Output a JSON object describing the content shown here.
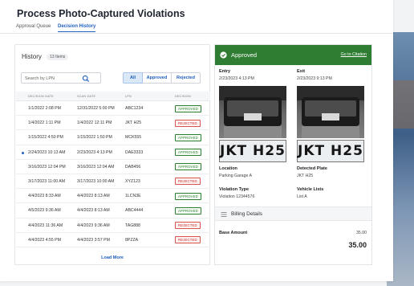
{
  "page": {
    "title": "Process Photo-Captured Violations"
  },
  "tabs": [
    {
      "label": "Approval Queue",
      "active": false
    },
    {
      "label": "Decision History",
      "active": true
    }
  ],
  "history": {
    "title": "History",
    "count_label": "13 Items",
    "search_placeholder": "Search by LPN",
    "filters": [
      "All",
      "Approved",
      "Rejected"
    ],
    "active_filter": "All",
    "columns": [
      "DECISION DATE",
      "SCAN DATE",
      "LPN",
      "DECISION"
    ],
    "rows": [
      {
        "decision_date": "1/1/2022  2:08 PM",
        "scan_date": "12/31/2022  5:00 PM",
        "lpn": "ABC1234",
        "decision": "APPROVED",
        "selected": false
      },
      {
        "decision_date": "1/4/2022 1:11 PM",
        "scan_date": "1/4/2022 12:11 PM",
        "lpn": "JKT H25",
        "decision": "REJECTED",
        "selected": false
      },
      {
        "decision_date": "1/15/2022 4:50 PM",
        "scan_date": "1/15/2022 1:50 PM",
        "lpn": "MCK555",
        "decision": "APPROVED",
        "selected": false
      },
      {
        "decision_date": "2/24/2023 10:13 AM",
        "scan_date": "2/23/2023 4:13 PM",
        "lpn": "DAE3333",
        "decision": "APPROVED",
        "selected": true
      },
      {
        "decision_date": "3/16/2023 12:04 PM",
        "scan_date": "3/16/2023 12:04 AM",
        "lpn": "DAB456",
        "decision": "APPROVED",
        "selected": false
      },
      {
        "decision_date": "3/17/2023 11:00 AM",
        "scan_date": "3/17/2023 10:00 AM",
        "lpn": "XYZ123",
        "decision": "REJECTED",
        "selected": false
      },
      {
        "decision_date": "4/4/2023 8:33 AM",
        "scan_date": "4/4/2023 8:13 AM",
        "lpn": "1LCN3E",
        "decision": "APPROVED",
        "selected": false
      },
      {
        "decision_date": "4/5/2023 9:36 AM",
        "scan_date": "4/4/2023 8:13 AM",
        "lpn": "ABC4444",
        "decision": "APPROVED",
        "selected": false
      },
      {
        "decision_date": "4/4/2023 11:36 AM",
        "scan_date": "4/4/2023 9:36 AM",
        "lpn": "TAG888",
        "decision": "REJECTED",
        "selected": false
      },
      {
        "decision_date": "4/4/2023 4:55 PM",
        "scan_date": "4/4/2023 3:57 PM",
        "lpn": "8PZZA",
        "decision": "REJECTED",
        "selected": false
      }
    ],
    "load_more_label": "Load More"
  },
  "detail": {
    "status": "Approved",
    "citation_link": "Go to Citation",
    "entry": {
      "label": "Entry",
      "timestamp": "2/23/2023 4:13 PM",
      "plate_text": "JKT H25"
    },
    "exit": {
      "label": "Exit",
      "timestamp": "2/23/2023 9:13 PM",
      "plate_text": "JKT H25"
    },
    "location": {
      "label": "Location",
      "value": "Parking Garage A"
    },
    "detected_plate": {
      "label": "Detected Plate",
      "value": "JKT H25"
    },
    "violation_type": {
      "label": "Violation Type",
      "value": "Violation 12344576"
    },
    "vehicle_lists": {
      "label": "Vehicle Lists",
      "value": "List A"
    },
    "billing": {
      "title": "Billing Details",
      "base_amount_label": "Base Amount",
      "base_amount_value": "35.00",
      "total_value": "35.00"
    }
  },
  "colors": {
    "accent": "#1f5fbf",
    "approved": "#2e7d32",
    "rejected": "#c62828"
  },
  "icons": [
    "search-icon",
    "check-circle-icon",
    "list-icon"
  ]
}
